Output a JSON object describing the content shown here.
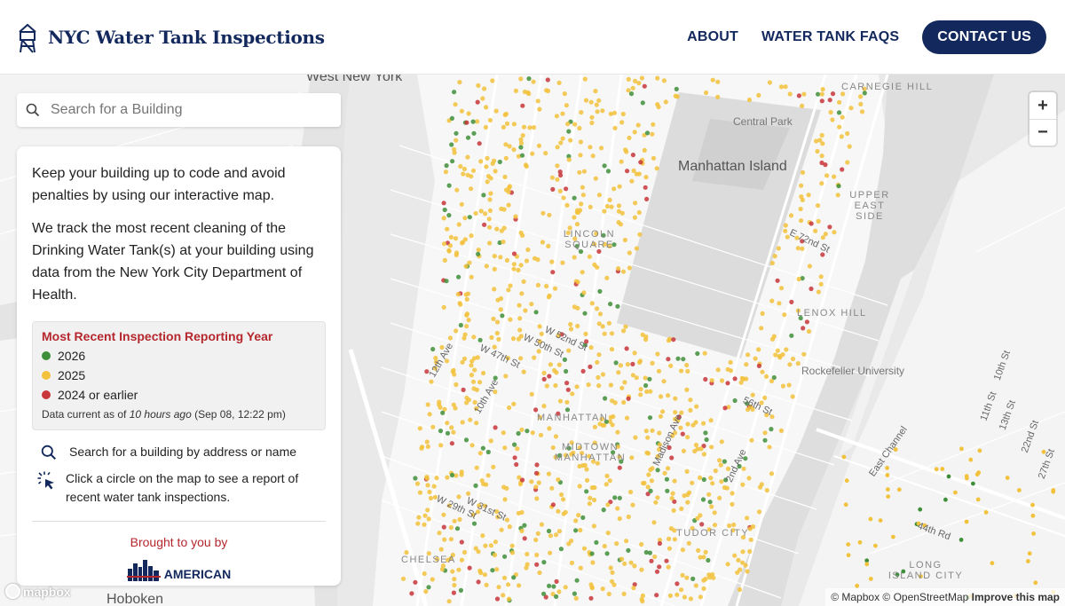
{
  "header": {
    "title": "NYC Water Tank Inspections",
    "nav": {
      "about": "ABOUT",
      "faqs": "WATER TANK FAQS",
      "contact": "CONTACT US"
    },
    "brand_color": "#13285c"
  },
  "search": {
    "placeholder": "Search for a Building"
  },
  "panel": {
    "intro": "Keep your building up to code and avoid penalties by using our interactive map.",
    "description": "We track the most recent cleaning of the Drinking Water Tank(s) at your building using data from the New York City Department of Health.",
    "legend": {
      "title": "Most Recent Inspection Reporting Year",
      "items": [
        {
          "label": "2026",
          "color": "#3f8f3a"
        },
        {
          "label": "2025",
          "color": "#f2c23c"
        },
        {
          "label": "2024 or earlier",
          "color": "#c8363a"
        }
      ],
      "note_prefix": "Data current as of ",
      "note_relative": "10 hours ago",
      "note_suffix": " (Sep 08, 12:22 pm)"
    },
    "help": {
      "search": "Search for a building by address or name",
      "click": "Click a circle on the map to see a report of recent water tank inspections."
    },
    "brought_by": "Brought to you by",
    "sponsor": "AMERICAN"
  },
  "map": {
    "labels": {
      "west_new_york": "West New York",
      "central_park": "Central Park",
      "manhattan_island": "Manhattan Island",
      "upper_east_side": "UPPER EAST SIDE",
      "lincoln_square": "LINCOLN SQUARE",
      "lenox_hill": "LENOX HILL",
      "rockefeller": "Rockefeller University",
      "manhattan": "MANHATTAN",
      "midtown": "MIDTOWN MANHATTAN",
      "chelsea": "CHELSEA",
      "tudor_city": "TUDOR CITY",
      "long_island_city": "LONG ISLAND CITY",
      "hoboken": "Hoboken",
      "carnegie_hill": "CARNEGIE HILL",
      "east_channel": "East Channel",
      "twelfth_ave": "12th Ave",
      "tenth_ave": "10th Ave",
      "w52": "W 52nd St",
      "w50": "W 50th St",
      "w47": "W 47th St",
      "w31": "W 31st St",
      "w29": "W 29th St",
      "madison": "Madison Ave",
      "e72": "E 72nd St",
      "e56": "56th St",
      "e44": "44th Rd",
      "second_ave": "2nd Ave",
      "eleventh": "11th St",
      "thirteenth": "13th St",
      "twentysecond": "22nd St",
      "twentyseventh": "27th St",
      "tenth_st": "10th St"
    },
    "zoom_in": "+",
    "zoom_out": "−",
    "attribution": "© Mapbox © OpenStreetMap",
    "improve": "Improve this map",
    "logo": "mapbox",
    "colors": {
      "green": "#3f8f3a",
      "yellow": "#f2c23c",
      "red": "#c8363a"
    }
  }
}
